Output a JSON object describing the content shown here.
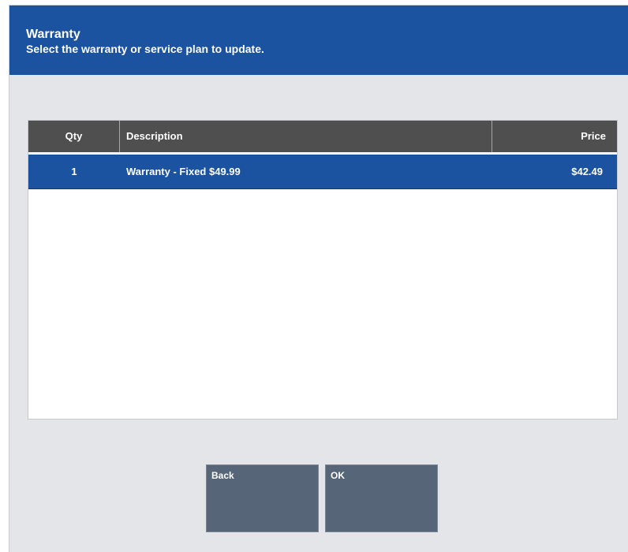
{
  "header": {
    "title": "Warranty",
    "subtitle": "Select the warranty or service plan to update."
  },
  "table": {
    "columns": [
      "Qty",
      "Description",
      "Price"
    ],
    "rows": [
      {
        "qty": "1",
        "description": "Warranty - Fixed $49.99",
        "price": "$42.49",
        "selected": true
      }
    ]
  },
  "buttons": {
    "back": "Back",
    "ok": "OK"
  },
  "colors": {
    "header_bg": "#1c53a0",
    "table_header_bg": "#4f4f4f",
    "selected_row_bg": "#1c53a0",
    "button_bg": "#566577",
    "panel_bg": "#e3e5e9"
  }
}
